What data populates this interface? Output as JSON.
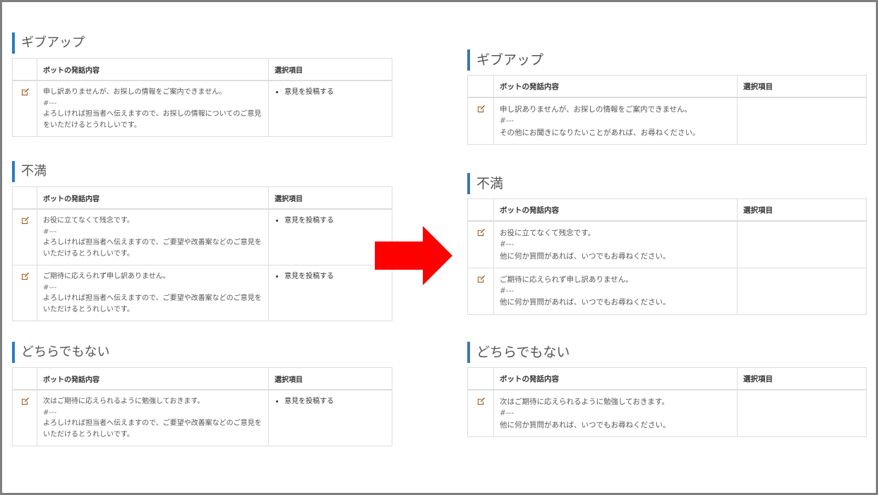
{
  "left": {
    "sections": [
      {
        "heading": "ギブアップ",
        "col_message": "ボットの発話内容",
        "col_choice": "選択項目",
        "rows": [
          {
            "line1": "申し訳ありませんが、お探しの情報をご案内できません。",
            "sep": "#---",
            "line2": "よろしければ担当者へ伝えますので、お探しの情報についてのご意見をいただけるとうれしいです。",
            "choice": "意見を投稿する"
          }
        ]
      },
      {
        "heading": "不満",
        "col_message": "ボットの発話内容",
        "col_choice": "選択項目",
        "rows": [
          {
            "line1": "お役に立てなくて残念です。",
            "sep": "#---",
            "line2": "よろしければ担当者へ伝えますので、ご要望や改善案などのご意見をいただけるとうれしいです。",
            "choice": "意見を投稿する"
          },
          {
            "line1": "ご期待に応えられず申し訳ありません。",
            "sep": "#---",
            "line2": "よろしければ担当者へ伝えますので、ご要望や改善案などのご意見をいただけるとうれしいです。",
            "choice": "意見を投稿する"
          }
        ]
      },
      {
        "heading": "どちらでもない",
        "col_message": "ボットの発話内容",
        "col_choice": "選択項目",
        "rows": [
          {
            "line1": "次はご期待に応えられるように勉強しておきます。",
            "sep": "#---",
            "line2": "よろしければ担当者へ伝えますので、ご要望や改善案などのご意見をいただけるとうれしいです。",
            "choice": "意見を投稿する"
          }
        ]
      }
    ]
  },
  "right": {
    "sections": [
      {
        "heading": "ギブアップ",
        "col_message": "ボットの発話内容",
        "col_choice": "選択項目",
        "rows": [
          {
            "line1": "申し訳ありませんが、お探しの情報をご案内できません。",
            "sep": "#---",
            "line2": "その他にお聞きになりたいことがあれば、お尋ねください。",
            "choice": ""
          }
        ]
      },
      {
        "heading": "不満",
        "col_message": "ボットの発話内容",
        "col_choice": "選択項目",
        "rows": [
          {
            "line1": "お役に立てなくて残念です。",
            "sep": "#---",
            "line2": "他に何か質問があれば、いつでもお尋ねください。",
            "choice": ""
          },
          {
            "line1": "ご期待に応えられず申し訳ありません。",
            "sep": "#---",
            "line2": "他に何か質問があれば、いつでもお尋ねください。",
            "choice": ""
          }
        ]
      },
      {
        "heading": "どちらでもない",
        "col_message": "ボットの発話内容",
        "col_choice": "選択項目",
        "rows": [
          {
            "line1": "次はご期待に応えられるように勉強しておきます。",
            "sep": "#---",
            "line2": "他に何か質問があれば、いつでもお尋ねください。",
            "choice": ""
          }
        ]
      }
    ]
  },
  "colors": {
    "heading_accent": "#337ab7",
    "arrow": "#ff0000",
    "edit_icon": "#8a4b08",
    "frame_border": "#7f7f7f"
  },
  "icons": {
    "edit": "edit-icon",
    "arrow": "right-arrow-icon"
  }
}
